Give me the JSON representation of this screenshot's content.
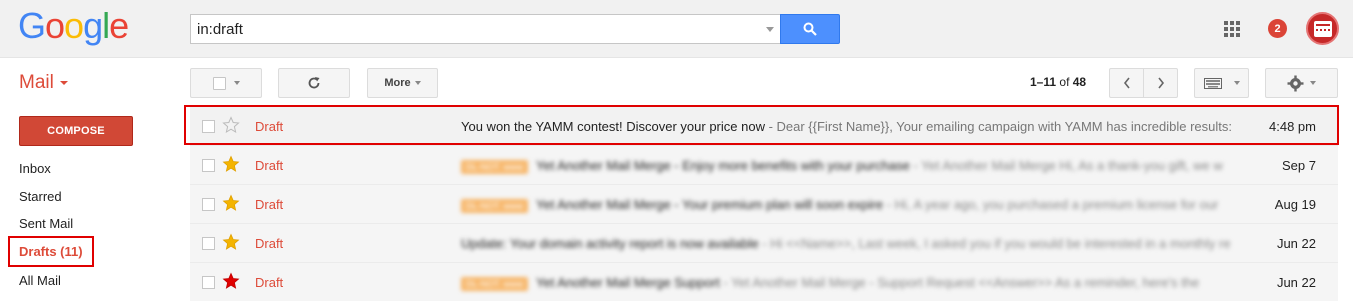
{
  "header": {
    "logo": [
      "G",
      "o",
      "o",
      "g",
      "l",
      "e"
    ],
    "logo_colors": [
      "#4285f4",
      "#ea4335",
      "#fbbc05",
      "#4285f4",
      "#34a853",
      "#ea4335"
    ],
    "search_value": "in:draft",
    "search_icon": "search-icon",
    "apps_icon": "apps-grid-icon",
    "notification_count": "2"
  },
  "toolbar": {
    "mail_label": "Mail",
    "more_label": "More",
    "pager_range": "1–11",
    "pager_of": "of",
    "pager_total": "48"
  },
  "sidebar": {
    "compose_label": "COMPOSE",
    "items": [
      {
        "label": "Inbox"
      },
      {
        "label": "Starred"
      },
      {
        "label": "Sent Mail"
      },
      {
        "label": "Drafts (11)"
      },
      {
        "label": "All Mail"
      }
    ]
  },
  "messages": [
    {
      "sender": "Draft",
      "subject": "You won the YAMM contest! Discover your price now",
      "snippet": " - Dear {{First Name}}, Your emailing campaign with YAMM has incredible results: W",
      "date": "4:48 pm",
      "star": "empty"
    },
    {
      "sender": "Draft",
      "label": "DL-NOT. www",
      "subject": "Yet Another Mail Merge - Enjoy more benefits with your purchase",
      "snippet": " - Yet Another Mail Merge Hi, As a thank-you gift, we w",
      "date": "Sep 7",
      "star": "yellow"
    },
    {
      "sender": "Draft",
      "label": "DL-NOT. www",
      "subject": "Yet Another Mail Merge - Your premium plan will soon expire",
      "snippet": " - Hi, A year ago, you purchased a premium license for our",
      "date": "Aug 19",
      "star": "yellow"
    },
    {
      "sender": "Draft",
      "label": "",
      "subject": "Update: Your domain activity report is now available",
      "snippet": " - Hi <<Name>>, Last week, I asked you if you would be interested in a monthly rep",
      "date": "Jun 22",
      "star": "yellow"
    },
    {
      "sender": "Draft",
      "label": "DL-NOT. www",
      "subject": "Yet Another Mail Merge Support",
      "snippet": " - Yet Another Mail Merge - Support Request <<Answer>> As a reminder, here's the",
      "date": "Jun 22",
      "star": "red"
    }
  ],
  "colors": {
    "brand_red": "#dd4b39",
    "compose_red": "#d14836",
    "search_blue": "#4d90fe",
    "highlight_red": "#e00000",
    "star_yellow": "#f4b400",
    "star_red": "#e00000"
  }
}
